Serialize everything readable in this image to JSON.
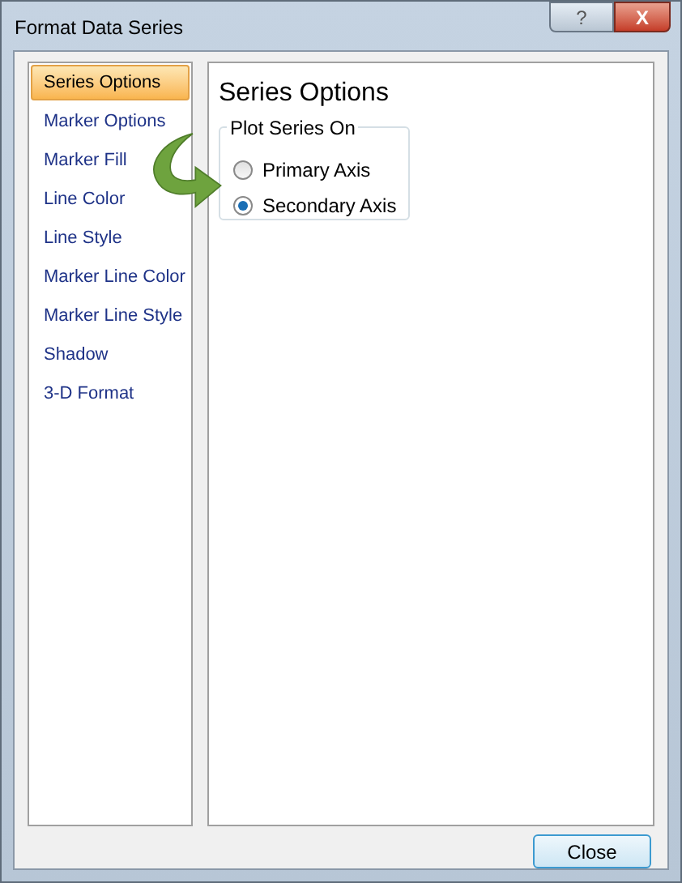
{
  "window": {
    "title": "Format Data Series",
    "help_glyph": "?",
    "close_glyph": "X"
  },
  "sidebar": {
    "items": [
      {
        "label": "Series Options",
        "selected": true
      },
      {
        "label": "Marker Options",
        "selected": false
      },
      {
        "label": "Marker Fill",
        "selected": false
      },
      {
        "label": "Line Color",
        "selected": false
      },
      {
        "label": "Line Style",
        "selected": false
      },
      {
        "label": "Marker Line Color",
        "selected": false
      },
      {
        "label": "Marker Line Style",
        "selected": false
      },
      {
        "label": "Shadow",
        "selected": false
      },
      {
        "label": "3-D Format",
        "selected": false
      }
    ]
  },
  "panel": {
    "heading": "Series Options",
    "group": {
      "legend": "Plot Series On",
      "options": [
        {
          "label": "Primary Axis",
          "selected": false
        },
        {
          "label": "Secondary Axis",
          "selected": true
        }
      ]
    }
  },
  "buttons": [
    "Close"
  ]
}
